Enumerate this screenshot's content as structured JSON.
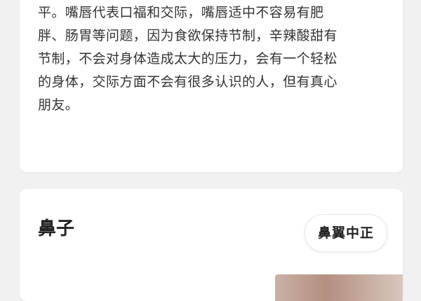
{
  "top_card": {
    "lines": [
      "平。嘴唇代表口福和交际，嘴唇适中不容易有肥",
      "胖、肠胃等问题，因为食欲保持节制，辛辣酸甜有",
      "节制，不会对身体造成太大的压力，会有一个轻松",
      "的身体，交际方面不会有很多认识的人，但有真心",
      "朋友。"
    ]
  },
  "bottom_card": {
    "title": "鼻子",
    "tag_label": "鼻翼中正"
  }
}
